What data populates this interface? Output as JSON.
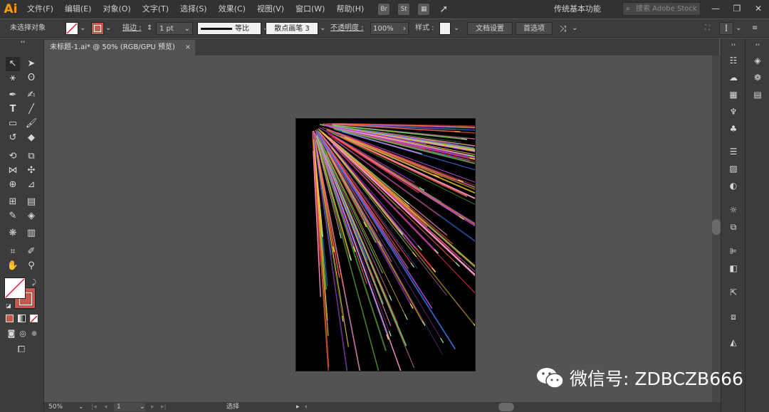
{
  "app": {
    "logo": "Ai",
    "workspace": "传统基本功能",
    "search_placeholder": "搜索 Adobe Stock"
  },
  "menu": [
    "文件(F)",
    "编辑(E)",
    "对象(O)",
    "文字(T)",
    "选择(S)",
    "效果(C)",
    "视图(V)",
    "窗口(W)",
    "帮助(H)"
  ],
  "menu_icons": [
    "bridge-icon",
    "stock-icon",
    "arrange-documents-icon",
    "gpu-rocket-icon"
  ],
  "window": {
    "minimize": "—",
    "restore": "❐",
    "close": "✕"
  },
  "control": {
    "selection_label": "未选择对象",
    "stroke_label": "描边 :",
    "stroke_weight": "1 pt",
    "stroke_profile": "等比",
    "brush": "散点画笔 3",
    "opacity_label": "不透明度 :",
    "opacity_value": "100%",
    "style_label": "样式 :",
    "doc_setup": "文档设置",
    "preferences": "首选项"
  },
  "tab": {
    "title": "未标题-1.ai* @ 50% (RGB/GPU 预览)",
    "close": "×"
  },
  "status": {
    "zoom": "50%",
    "page": "1",
    "mode": "选择"
  },
  "watermark": {
    "text": "微信号: ZDBCZB666"
  },
  "artwork": {
    "description_colors": [
      "#e8354a",
      "#ff6a3d",
      "#f3c43a",
      "#7bd650",
      "#3d7ef5",
      "#a54bd8",
      "#ff9ad1",
      "#ffffff"
    ],
    "ray_count": 150
  },
  "colors": {
    "fill": "#ffffff",
    "stroke": "#c35a4f",
    "accent": "#ff9a00"
  }
}
